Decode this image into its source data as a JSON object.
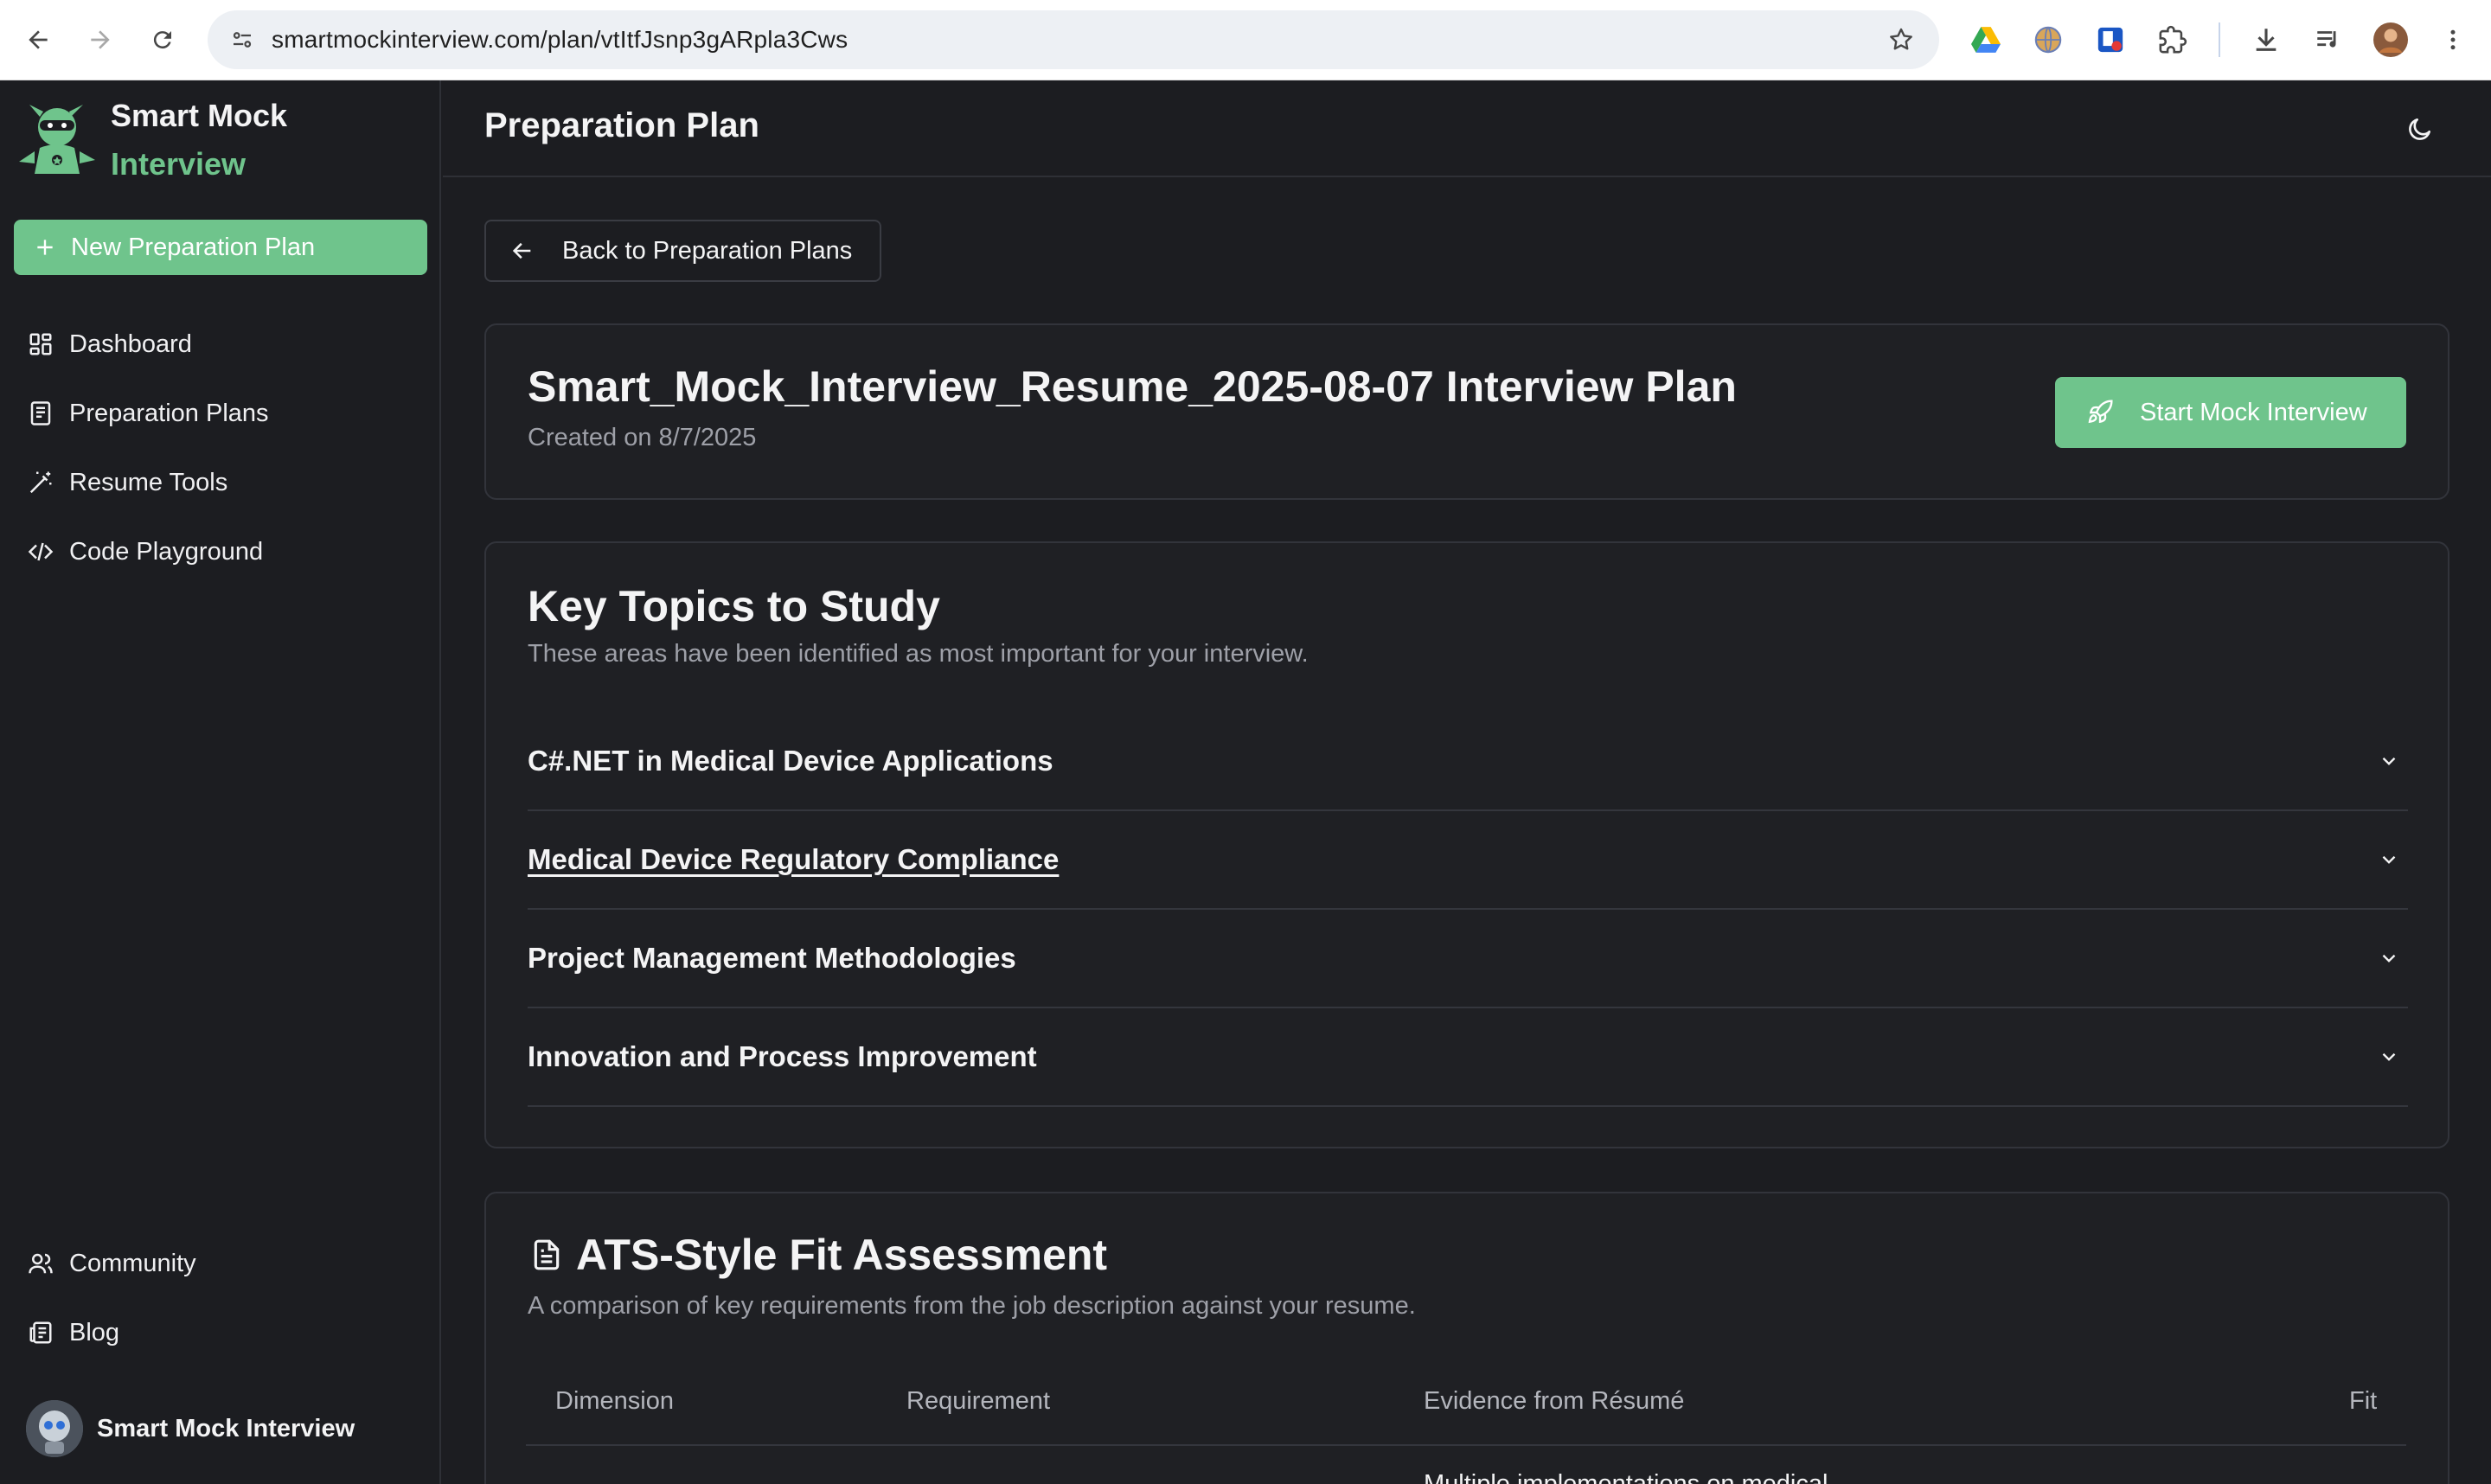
{
  "browser": {
    "url": "smartmockinterview.com/plan/vtItfJsnp3gARpla3Cws",
    "extensions": [
      "google-drive-icon",
      "globe-extension-icon",
      "blue-extension-icon",
      "puzzle-icon",
      "download-icon",
      "media-control-icon",
      "profile-avatar",
      "more-vert-icon"
    ]
  },
  "sidebar": {
    "brand_line1": "Smart Mock",
    "brand_line2": "Interview",
    "new_plan_label": "New Preparation Plan",
    "items": [
      {
        "label": "Dashboard",
        "icon": "dashboard-icon"
      },
      {
        "label": "Preparation Plans",
        "icon": "document-icon"
      },
      {
        "label": "Resume Tools",
        "icon": "magic-wand-icon"
      },
      {
        "label": "Code Playground",
        "icon": "code-icon"
      }
    ],
    "bottom_items": [
      {
        "label": "Community",
        "icon": "users-icon"
      },
      {
        "label": "Blog",
        "icon": "newspaper-icon"
      }
    ],
    "user_name": "Smart Mock Interview"
  },
  "header": {
    "title": "Preparation Plan"
  },
  "back_label": "Back to Preparation Plans",
  "plan": {
    "title": "Smart_Mock_Interview_Resume_2025-08-07 Interview Plan",
    "created": "Created on 8/7/2025",
    "start_label": "Start Mock Interview"
  },
  "topics": {
    "title": "Key Topics to Study",
    "subtitle": "These areas have been identified as most important for your interview.",
    "items": [
      "C#.NET in Medical Device Applications",
      "Medical Device Regulatory Compliance",
      "Project Management Methodologies",
      "Innovation and Process Improvement"
    ]
  },
  "ats": {
    "title": "ATS-Style Fit Assessment",
    "subtitle": "A comparison of key requirements from the job description against your resume.",
    "columns": [
      "Dimension",
      "Requirement",
      "Evidence from Résumé",
      "Fit"
    ],
    "first_row_evidence": "Multiple implementations on medical"
  },
  "colors": {
    "accent": "#6fc48c",
    "background": "#1c1d21",
    "card": "#1f2024"
  }
}
